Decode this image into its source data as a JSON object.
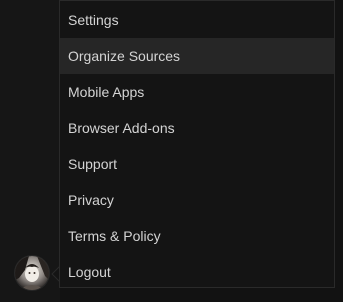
{
  "colors": {
    "menu_background": "#141414",
    "menu_border": "#2a2a2a",
    "active_item_background": "#262626",
    "text": "#d4d4d4",
    "rail_background": "#161616"
  },
  "user": {
    "avatar_icon": "user-avatar-icon"
  },
  "menu": {
    "active_index": 1,
    "items": [
      {
        "label": "Settings"
      },
      {
        "label": "Organize Sources"
      },
      {
        "label": "Mobile Apps"
      },
      {
        "label": "Browser Add-ons"
      },
      {
        "label": "Support"
      },
      {
        "label": "Privacy"
      },
      {
        "label": "Terms & Policy"
      },
      {
        "label": "Logout"
      }
    ]
  }
}
